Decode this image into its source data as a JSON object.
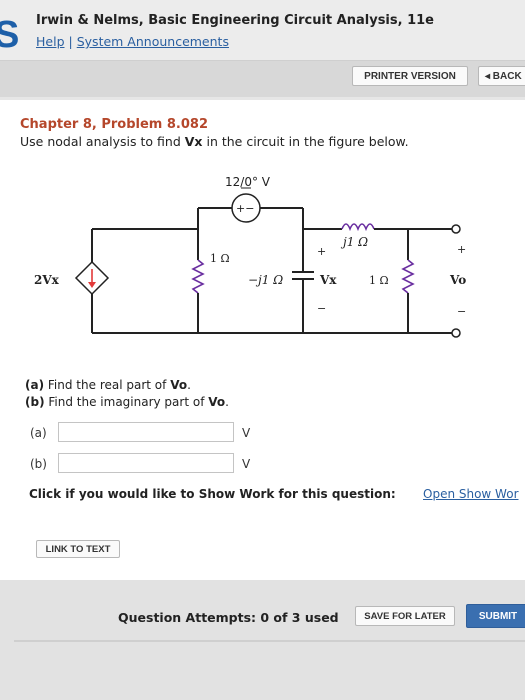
{
  "header": {
    "logo": "S",
    "book_title": "Irwin & Nelms, Basic Engineering Circuit Analysis, 11e",
    "links": [
      "Help",
      "System Announcements"
    ],
    "separator": "|"
  },
  "toolbar": {
    "printer_label": "PRINTER VERSION",
    "back_label": "◂ BACK"
  },
  "problem": {
    "title": "Chapter 8, Problem 8.082",
    "text_before": "Use nodal analysis to find ",
    "text_var": "Vx",
    "text_after": " in the circuit in the figure below."
  },
  "circuit": {
    "source_label": "12/0° V",
    "source_polarity": "+−",
    "inductor_label": "j1 Ω",
    "r1_label": "1 Ω",
    "cap_label": "−j1 Ω",
    "vx_label": "Vx",
    "r2_label": "1 Ω",
    "dep_source_label": "2Vx",
    "vo_label": "Vo",
    "plus": "+",
    "minus": "−"
  },
  "parts": {
    "a_tag": "(a)",
    "a_text": "Find the real part of ",
    "b_tag": "(b)",
    "b_text": "Find the imaginary part of ",
    "var": "Vo",
    "period": "."
  },
  "answers": [
    {
      "label": "(a)",
      "value": "",
      "unit": "V"
    },
    {
      "label": "(b)",
      "value": "",
      "unit": "V"
    }
  ],
  "show_work": {
    "prompt": "Click if you would like to Show Work for this question:",
    "link": "Open Show Wor"
  },
  "link_to_text": "LINK TO TEXT",
  "footer": {
    "attempts": "Question Attempts: 0 of 3 used",
    "save_label": "SAVE FOR LATER",
    "submit_label": "SUBMIT"
  }
}
